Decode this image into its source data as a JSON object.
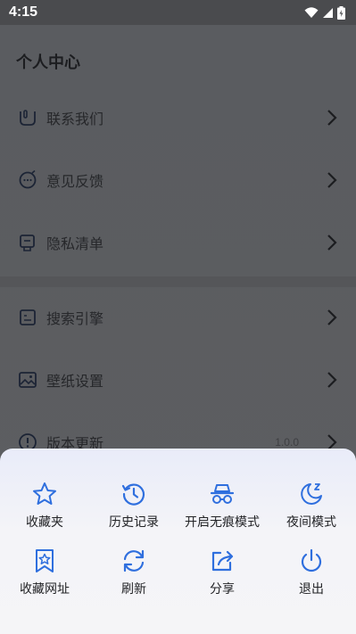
{
  "status_bar": {
    "time": "4:15",
    "icons": [
      "wifi-icon",
      "cellular-signal-icon",
      "battery-charging-icon"
    ]
  },
  "page": {
    "title": "个人中心",
    "menu_items": [
      {
        "label": "联系我们",
        "icon": "headset-icon"
      },
      {
        "label": "意见反馈",
        "icon": "feedback-chat-icon"
      },
      {
        "label": "隐私清单",
        "icon": "privacy-list-icon"
      },
      {
        "label": "搜索引擎",
        "icon": "search-engine-icon"
      },
      {
        "label": "壁纸设置",
        "icon": "wallpaper-icon"
      },
      {
        "label": "版本更新",
        "icon": "info-icon",
        "value": "1.0.0"
      }
    ]
  },
  "sheet": {
    "accent_color": "#2f6fde",
    "items": [
      {
        "label": "收藏夹",
        "icon": "star-icon"
      },
      {
        "label": "历史记录",
        "icon": "history-icon"
      },
      {
        "label": "开启无痕模式",
        "icon": "incognito-icon"
      },
      {
        "label": "夜间模式",
        "icon": "moon-icon"
      },
      {
        "label": "收藏网址",
        "icon": "bookmark-star-icon"
      },
      {
        "label": "刷新",
        "icon": "refresh-icon"
      },
      {
        "label": "分享",
        "icon": "share-icon"
      },
      {
        "label": "退出",
        "icon": "power-icon"
      }
    ]
  }
}
